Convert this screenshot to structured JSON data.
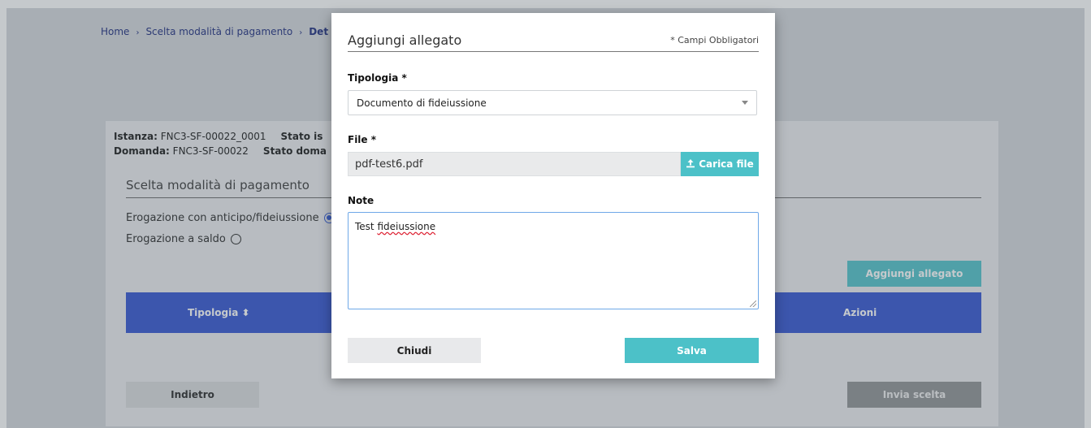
{
  "breadcrumb": {
    "items": [
      "Home",
      "Scelta modalità di pagamento",
      "Det"
    ],
    "separator": "›"
  },
  "meta": {
    "istanza_label": "Istanza:",
    "istanza_value": "FNC3-SF-00022_0001",
    "stato_istanza_label": "Stato is",
    "domanda_label": "Domanda:",
    "domanda_value": "FNC3-SF-00022",
    "stato_domanda_label": "Stato doma"
  },
  "section": {
    "title": "Scelta modalità di pagamento",
    "options": [
      {
        "label": "Erogazione con anticipo/fideiussione",
        "selected": true
      },
      {
        "label": "Erogazione a saldo",
        "selected": false
      }
    ]
  },
  "background_buttons": {
    "add_attachment": "Aggiungi allegato",
    "back": "Indietro",
    "send": "Invia scelta"
  },
  "table": {
    "columns": [
      "Tipologia",
      "Azioni"
    ],
    "sort_icon": "⬍"
  },
  "modal": {
    "title": "Aggiungi allegato",
    "required_note": "* Campi Obbligatori",
    "tipologia_label": "Tipologia *",
    "tipologia_value": "Documento di fideiussione",
    "file_label": "File *",
    "file_value": "pdf-test6.pdf",
    "upload_label": "Carica file",
    "note_label": "Note",
    "note_value_prefix": "Test ",
    "note_value_word": "fideiussione",
    "close_label": "Chiudi",
    "save_label": "Salva"
  },
  "colors": {
    "accent_teal": "#4cc1c8",
    "table_header_blue": "#2d4fd0",
    "breadcrumb_blue": "#16257a"
  }
}
